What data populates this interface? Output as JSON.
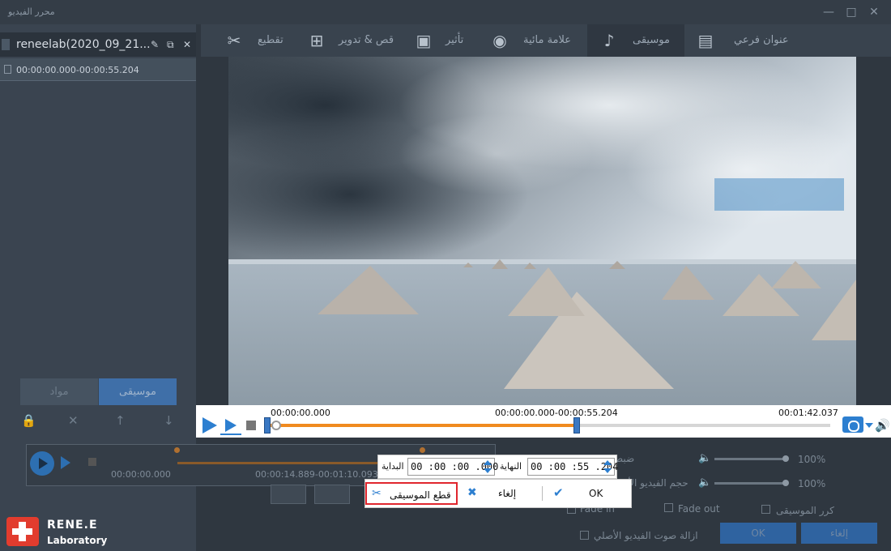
{
  "window": {
    "title": "محرر الفيديو",
    "controls": [
      "minimize",
      "maximize",
      "close"
    ]
  },
  "clip": {
    "name": "reneelab(2020_09_21...",
    "time_range": "00:00:00.000-00:00:55.204"
  },
  "left_tabs": {
    "music": "موسيقى",
    "material": "مواد"
  },
  "top_tabs": [
    {
      "label": "عنوان فرعي",
      "icon": "subtitle-icon",
      "active": false
    },
    {
      "label": "موسيقى",
      "icon": "music-note-icon",
      "active": true
    },
    {
      "label": "علامة مائية",
      "icon": "watermark-reel-icon",
      "active": false
    },
    {
      "label": "تأثير",
      "icon": "effect-film-icon",
      "active": false
    },
    {
      "label": "قص & تدوير",
      "icon": "crop-icon",
      "active": false
    },
    {
      "label": "تقطيع",
      "icon": "cut-icon",
      "active": false
    }
  ],
  "timeline": {
    "start": "00:00:00.000",
    "range": "00:00:00.000-00:00:55.204",
    "end": "00:01:42.037",
    "progress_fraction": 0.55
  },
  "editor": {
    "t_start": "00:00:00.000",
    "t_range": "00:00:14.889-00:01:10.093"
  },
  "right_panel": {
    "volume_label": "ضبط",
    "original_volume_label": "حجم الفيديو الأصلي",
    "volume1_value": "100%",
    "volume2_value": "100%",
    "fade_in": "Fade in",
    "fade_out": "Fade out",
    "loop_music": "كرر الموسيقى",
    "remove_original_audio": "ازالة صوت الفيديو الأصلي",
    "ok": "OK",
    "cancel": "إلغاء"
  },
  "trim_dialog": {
    "end_label": "النهاية",
    "end_value": "00 :00 :55 .204",
    "start_label": "البداية",
    "start_value": "00 :00 :00 .000",
    "cut_music": "قطع الموسيقى",
    "cancel": "إلغاء",
    "ok": "OK"
  },
  "logo": {
    "line1": "RENE.E",
    "line2": "Laboratory"
  }
}
